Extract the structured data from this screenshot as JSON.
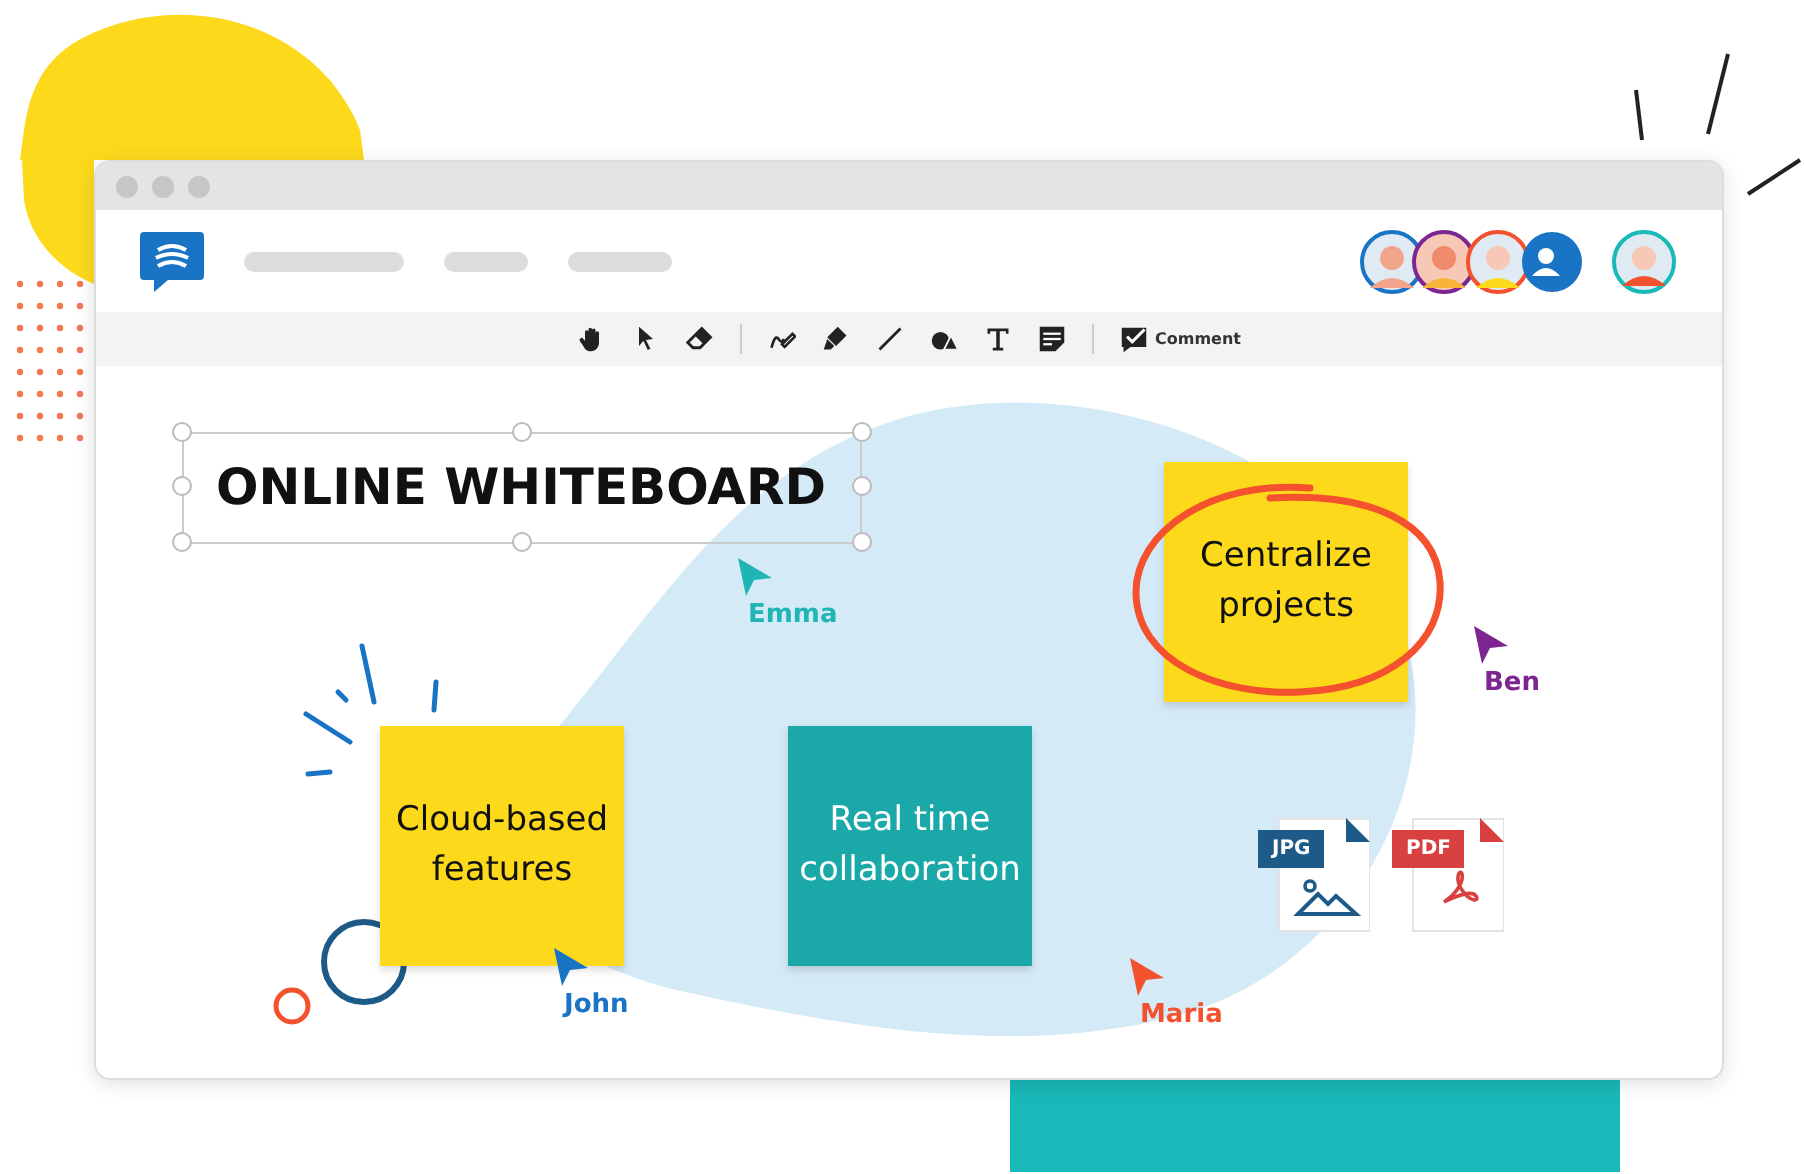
{
  "toolbar": {
    "tools": [
      {
        "kind": "hand"
      },
      {
        "kind": "pointer"
      },
      {
        "kind": "eraser"
      },
      {
        "kind": "separator"
      },
      {
        "kind": "pen"
      },
      {
        "kind": "marker"
      },
      {
        "kind": "line"
      },
      {
        "kind": "shapes"
      },
      {
        "kind": "text"
      },
      {
        "kind": "note"
      },
      {
        "kind": "separator"
      },
      {
        "kind": "comment",
        "label": "Comment"
      }
    ]
  },
  "board": {
    "title": "ONLINE WHITEBOARD",
    "notes": [
      {
        "text": "Centralize projects",
        "color": "#fdd91c",
        "circled": true
      },
      {
        "text": "Cloud-based features",
        "color": "#fdd91c",
        "circled": false
      },
      {
        "text": "Real time collaboration",
        "color": "#1aa8a8",
        "circled": false
      }
    ],
    "cursors": [
      {
        "name": "Emma",
        "color": "#1fb5b5"
      },
      {
        "name": "Ben",
        "color": "#7d2590"
      },
      {
        "name": "John",
        "color": "#1a74c6"
      },
      {
        "name": "Maria",
        "color": "#f4522e"
      }
    ],
    "files": [
      {
        "kind": "image",
        "label": "JPG",
        "color": "#1d5a87"
      },
      {
        "kind": "pdf",
        "label": "PDF",
        "color": "#d94141"
      }
    ]
  }
}
